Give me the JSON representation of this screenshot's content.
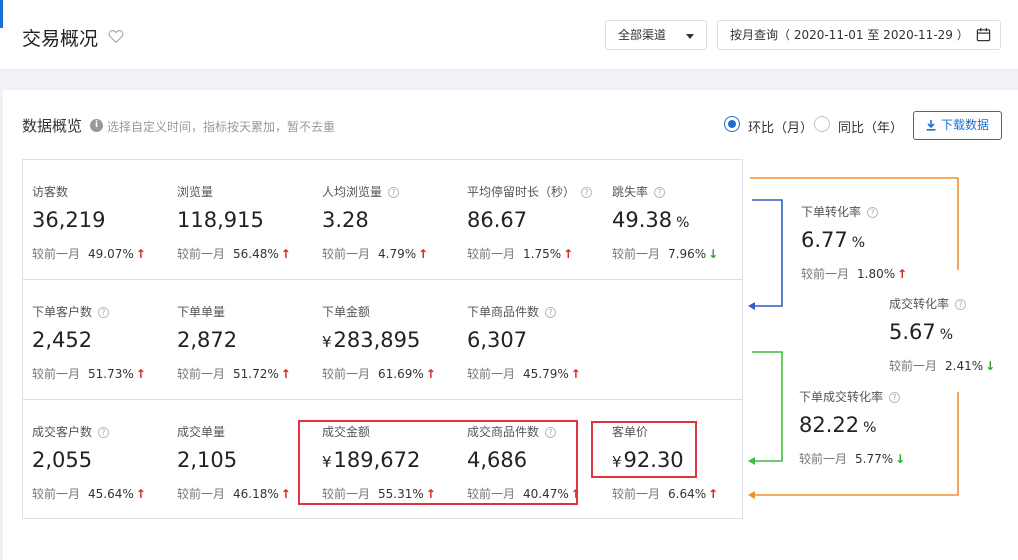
{
  "header": {
    "title": "交易概况",
    "channel_select": "全部渠道",
    "date_range": "按月查询（ 2020-11-01 至 2020-11-29 ）"
  },
  "overview": {
    "title": "数据概览",
    "hint": "选择自定义时间，指标按天累加，暂不去重",
    "radio_mom": "环比（月）",
    "radio_yoy": "同比（年）",
    "download": "下载数据"
  },
  "compare_label": "较前一月",
  "metrics": {
    "visitors": {
      "label": "访客数",
      "value": "36,219",
      "change": "49.07%",
      "trend": "up"
    },
    "pageviews": {
      "label": "浏览量",
      "value": "118,915",
      "change": "56.48%",
      "trend": "up"
    },
    "avg_views": {
      "label": "人均浏览量",
      "value": "3.28",
      "change": "4.79%",
      "trend": "up"
    },
    "avg_stay": {
      "label": "平均停留时长（秒）",
      "value": "86.67",
      "change": "1.75%",
      "trend": "up"
    },
    "bounce_rate": {
      "label": "跳失率",
      "value": "49.38",
      "unit": "%",
      "change": "7.96%",
      "trend": "down"
    },
    "order_customers": {
      "label": "下单客户数",
      "value": "2,452",
      "change": "51.73%",
      "trend": "up"
    },
    "order_count": {
      "label": "下单单量",
      "value": "2,872",
      "change": "51.72%",
      "trend": "up"
    },
    "order_amount": {
      "label": "下单金额",
      "currency": "¥",
      "value": "283,895",
      "change": "61.69%",
      "trend": "up"
    },
    "order_items": {
      "label": "下单商品件数",
      "value": "6,307",
      "change": "45.79%",
      "trend": "up"
    },
    "deal_customers": {
      "label": "成交客户数",
      "value": "2,055",
      "change": "45.64%",
      "trend": "up"
    },
    "deal_count": {
      "label": "成交单量",
      "value": "2,105",
      "change": "46.18%",
      "trend": "up"
    },
    "deal_amount": {
      "label": "成交金额",
      "currency": "¥",
      "value": "189,672",
      "change": "55.31%",
      "trend": "up"
    },
    "deal_items": {
      "label": "成交商品件数",
      "value": "4,686",
      "change": "40.47%",
      "trend": "up"
    },
    "avg_order_value": {
      "label": "客单价",
      "currency": "¥",
      "value": "92.30",
      "change": "6.64%",
      "trend": "up"
    }
  },
  "conversion": {
    "order_rate": {
      "label": "下单转化率",
      "value": "6.77",
      "unit": "%",
      "change": "1.80%",
      "trend": "up"
    },
    "deal_rate": {
      "label": "成交转化率",
      "value": "5.67",
      "unit": "%",
      "change": "2.41%",
      "trend": "down"
    },
    "order_deal_rate": {
      "label": "下单成交转化率",
      "value": "82.22",
      "unit": "%",
      "change": "5.77%",
      "trend": "down"
    }
  },
  "colors": {
    "primary": "#1a6fd6",
    "up": "#e02020",
    "down": "#2aa52a",
    "highlight": "#e0343b",
    "flow_blue": "#2f5fc4",
    "flow_green": "#3cbf3c",
    "flow_orange": "#f0902a"
  }
}
